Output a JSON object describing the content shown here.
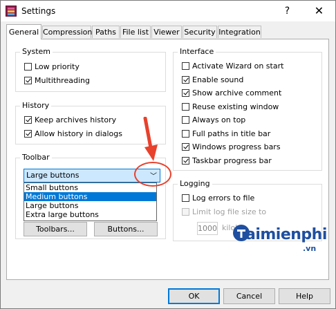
{
  "window": {
    "title": "Settings",
    "help_glyph": "?",
    "close_glyph": "✕"
  },
  "tabs": [
    "General",
    "Compression",
    "Paths",
    "File list",
    "Viewer",
    "Security",
    "Integration"
  ],
  "system": {
    "title": "System",
    "items": [
      {
        "label": "Low priority",
        "checked": false
      },
      {
        "label": "Multithreading",
        "checked": true
      }
    ]
  },
  "history": {
    "title": "History",
    "items": [
      {
        "label": "Keep archives history",
        "checked": true
      },
      {
        "label": "Allow history in dialogs",
        "checked": true
      }
    ]
  },
  "toolbar": {
    "title": "Toolbar",
    "selected": "Large buttons",
    "options": [
      "Small buttons",
      "Medium buttons",
      "Large buttons",
      "Extra large buttons"
    ],
    "highlighted_option": "Medium buttons",
    "toolbars_button": "Toolbars...",
    "buttons_button": "Buttons..."
  },
  "interface": {
    "title": "Interface",
    "items": [
      {
        "label": "Activate Wizard on start",
        "checked": false
      },
      {
        "label": "Enable sound",
        "checked": true
      },
      {
        "label": "Show archive comment",
        "checked": true
      },
      {
        "label": "Reuse existing window",
        "checked": false
      },
      {
        "label": "Always on top",
        "checked": false
      },
      {
        "label": "Full paths in title bar",
        "checked": false
      },
      {
        "label": "Windows progress bars",
        "checked": true
      },
      {
        "label": "Taskbar progress bar",
        "checked": true
      }
    ]
  },
  "logging": {
    "title": "Logging",
    "log_errors": {
      "label": "Log errors to file",
      "checked": false
    },
    "limit": {
      "label": "Limit log file size to",
      "checked": false
    },
    "size_value": "1000",
    "size_unit": "kiloby"
  },
  "footer": {
    "ok": "OK",
    "cancel": "Cancel",
    "help": "Help"
  },
  "watermark": {
    "text": "aimienphi",
    "sub": ".vn"
  },
  "colors": {
    "accent": "#0078d7",
    "annotation": "#e8412c"
  }
}
